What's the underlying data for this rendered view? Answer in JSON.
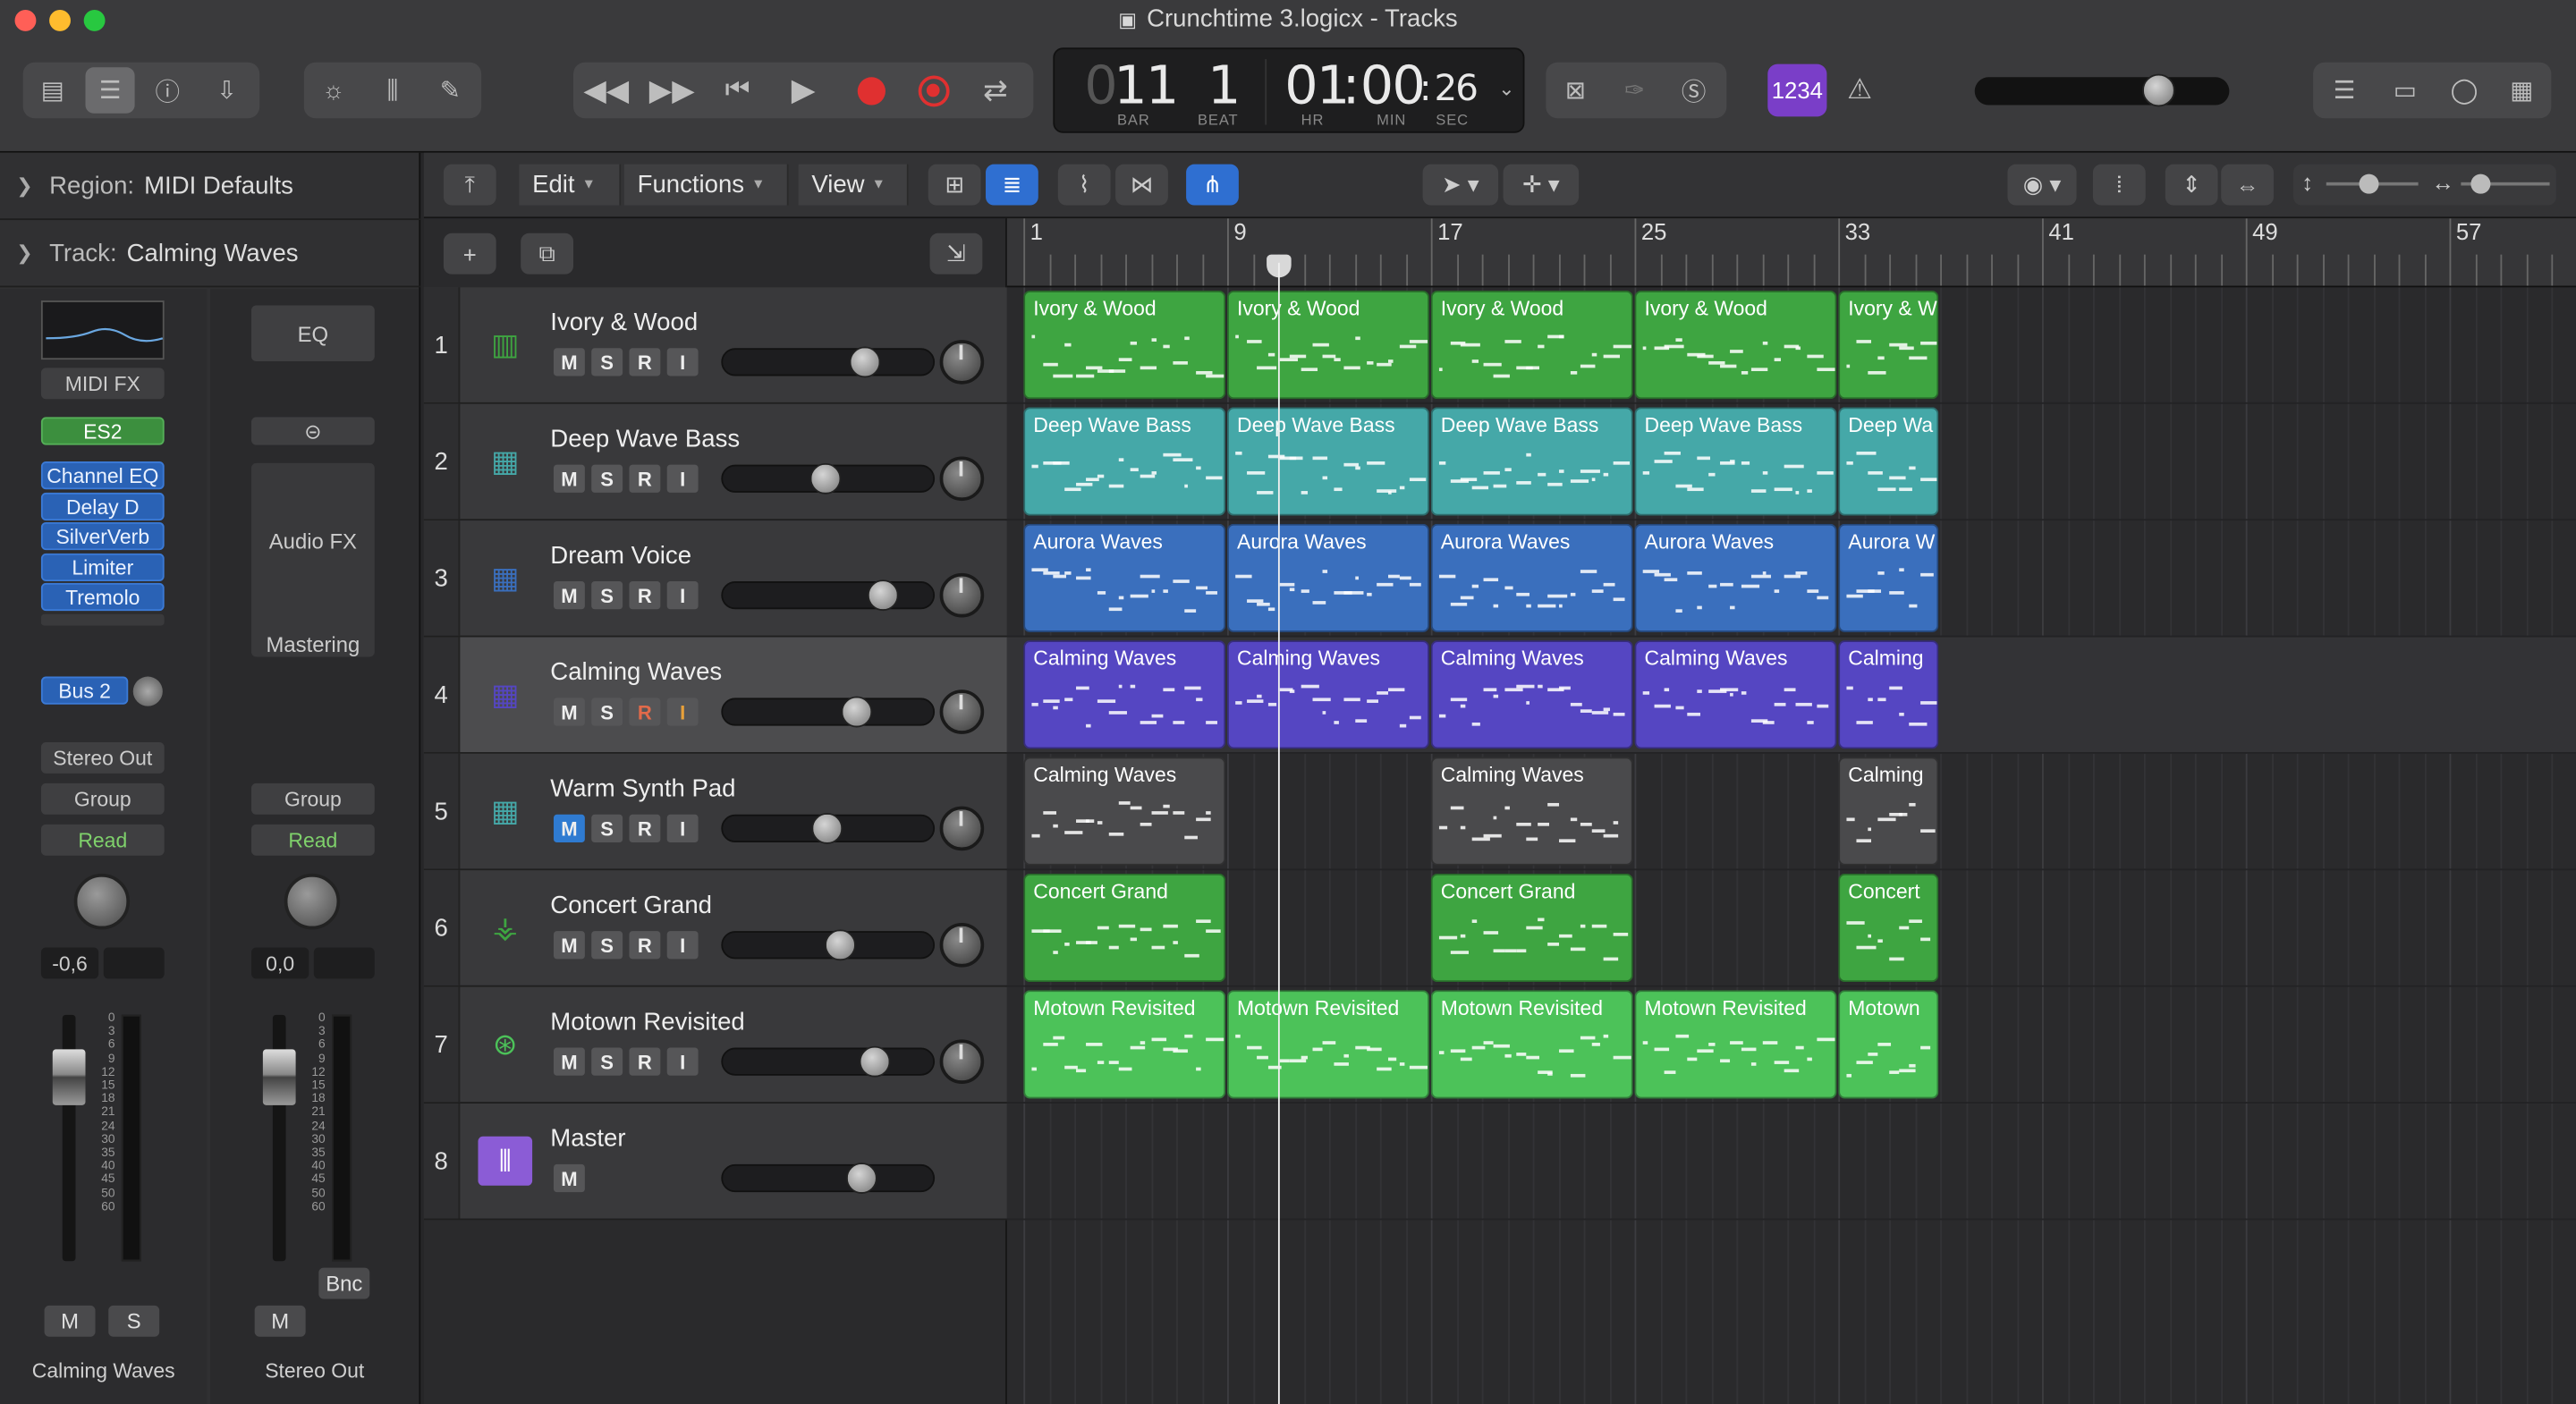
{
  "window": {
    "title": "Crunchtime 3.logicx - Tracks"
  },
  "colors": {
    "green": "#3ea541",
    "teal": "#45a8a8",
    "blue": "#3a6fbd",
    "purple": "#5546c2",
    "gray": "#4a4a4c",
    "lightgreen": "#4cc259"
  },
  "toolbar": {
    "left_icons": [
      "library-icon",
      "inspector-icon",
      "help-icon",
      "download-icon"
    ],
    "mid_icons": [
      "brightness-icon",
      "mixer-icon",
      "pencil-icon"
    ],
    "transport": [
      "rewind-icon",
      "fast-forward-icon",
      "go-to-start-icon",
      "play-icon",
      "record-icon",
      "replace-icon",
      "cycle-icon"
    ],
    "right_icons": [
      "list-icon",
      "notes-icon",
      "loops-icon",
      "browser-icon"
    ],
    "count_in": "1234"
  },
  "lcd": {
    "bar": "11",
    "beat": "1",
    "time_hr": "01",
    "time_min": "00",
    "time_sec": "26",
    "lcd_dim": "0",
    "bar_cap": "BAR",
    "beat_cap": "BEAT",
    "hr_cap": "HR",
    "min_cap": "MIN",
    "sec_cap": "SEC",
    "master_volume": 0.77
  },
  "inspector": {
    "region_label": "Region:",
    "region_value": "MIDI Defaults",
    "track_label": "Track:",
    "track_value": "Calming Waves",
    "strip1": {
      "midi_fx": "MIDI FX",
      "instrument": "ES2",
      "plugins": [
        "Channel EQ",
        "Delay D",
        "SilverVerb",
        "Limiter",
        "Tremolo"
      ],
      "send": "Bus 2",
      "output": "Stereo Out",
      "group": "Group",
      "automation": "Read",
      "volume": "-0,6",
      "m": "M",
      "s": "S",
      "name": "Calming Waves"
    },
    "strip2": {
      "eq": "EQ",
      "audio_fx": "Audio FX",
      "mastering": "Mastering",
      "group": "Group",
      "automation": "Read",
      "volume": "0,0",
      "m": "M",
      "bnc": "Bnc",
      "name": "Stereo Out"
    },
    "meter_scale": [
      "0",
      "3",
      "6",
      "9",
      "12",
      "15",
      "18",
      "21",
      "24",
      "30",
      "35",
      "40",
      "45",
      "50",
      "60"
    ]
  },
  "menubar": {
    "edit": "Edit",
    "functions": "Functions",
    "view": "View"
  },
  "ruler": {
    "bars": [
      "1",
      "9",
      "17",
      "25",
      "33",
      "41",
      "49",
      "57"
    ]
  },
  "tracks": [
    {
      "num": "1",
      "name": "Ivory & Wood",
      "color": "#3ea541",
      "icon": "piano-icon",
      "vol": 0.69,
      "sel": false,
      "mute": false
    },
    {
      "num": "2",
      "name": "Deep Wave Bass",
      "color": "#45a8a8",
      "icon": "keyboard-icon",
      "vol": 0.48,
      "sel": false,
      "mute": false
    },
    {
      "num": "3",
      "name": "Dream Voice",
      "color": "#3a6fbd",
      "icon": "keyboard-icon",
      "vol": 0.79,
      "sel": false,
      "mute": false
    },
    {
      "num": "4",
      "name": "Calming Waves",
      "color": "#5546c2",
      "icon": "keyboard-icon",
      "vol": 0.65,
      "sel": true,
      "mute": false
    },
    {
      "num": "5",
      "name": "Warm Synth Pad",
      "color": "#45a8a8",
      "icon": "keyboard-icon",
      "vol": 0.49,
      "sel": false,
      "mute": true
    },
    {
      "num": "6",
      "name": "Concert Grand",
      "color": "#3ea541",
      "icon": "grand-piano-icon",
      "vol": 0.56,
      "sel": false,
      "mute": false
    },
    {
      "num": "7",
      "name": "Motown Revisited",
      "color": "#4cc259",
      "icon": "drums-icon",
      "vol": 0.75,
      "sel": false,
      "mute": false
    },
    {
      "num": "8",
      "name": "Master",
      "color": "#8b5cd6",
      "icon": "waveform-icon",
      "vol": 0.68,
      "sel": false,
      "mute": false,
      "master": true
    }
  ],
  "track_buttons": {
    "m": "M",
    "s": "S",
    "r": "R",
    "i": "I"
  },
  "regions": [
    {
      "lane": 0,
      "name": "Ivory & Wood",
      "starts": [
        1,
        9,
        17,
        25,
        33
      ],
      "lens": [
        8,
        8,
        8,
        8,
        4
      ]
    },
    {
      "lane": 1,
      "name": "Deep Wave Bass",
      "starts": [
        1,
        9,
        17,
        25,
        33
      ],
      "lens": [
        8,
        8,
        8,
        8,
        4
      ],
      "short_last": "Deep Wa"
    },
    {
      "lane": 2,
      "name": "Aurora Waves",
      "starts": [
        1,
        9,
        17,
        25,
        33
      ],
      "lens": [
        8,
        8,
        8,
        8,
        4
      ],
      "short_last": "Aurora W"
    },
    {
      "lane": 3,
      "name": "Calming Waves",
      "starts": [
        1,
        9,
        17,
        25,
        33
      ],
      "lens": [
        8,
        8,
        8,
        8,
        4
      ],
      "short_last": "Calming"
    },
    {
      "lane": 4,
      "name": "Calming Waves",
      "starts": [
        1,
        17,
        33
      ],
      "lens": [
        8,
        8,
        4
      ],
      "short_last": "Calming"
    },
    {
      "lane": 5,
      "name": "Concert Grand",
      "starts": [
        1,
        17,
        33
      ],
      "lens": [
        8,
        8,
        4
      ],
      "short_last": "Concert"
    },
    {
      "lane": 6,
      "name": "Motown Revisited",
      "starts": [
        1,
        9,
        17,
        25,
        33
      ],
      "lens": [
        8,
        8,
        8,
        8,
        4
      ],
      "short_last": "Motown"
    }
  ],
  "playhead_bar": 11.4
}
